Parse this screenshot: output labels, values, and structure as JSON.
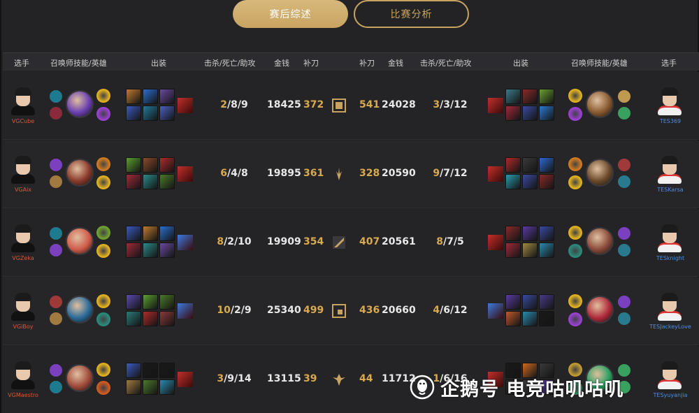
{
  "tabs": [
    {
      "label": "赛后综述",
      "active": true
    },
    {
      "label": "比赛分析",
      "active": false
    }
  ],
  "header": {
    "left": {
      "player": "选手",
      "spells_champ": "召唤师技能/英雄",
      "items": "出装",
      "kda": "击杀/死亡/助攻",
      "gold": "金钱",
      "cs": "补刀"
    },
    "right": {
      "cs": "补刀",
      "gold": "金钱",
      "kda": "击杀/死亡/助攻",
      "items": "出装",
      "spells_champ": "召唤师技能/英雄",
      "player": "选手"
    }
  },
  "rows": [
    {
      "lane": "top-icon",
      "left": {
        "name": "VGCube",
        "kda": "2/8/9",
        "k": "2",
        "rest": "/8/9",
        "gold": "18425",
        "cs": "372",
        "spells": [
          "#1e7a8f",
          "#8a2a3a"
        ],
        "champ": "#6a3fb0",
        "runes": [
          "#e0b020",
          "#9a40d0"
        ],
        "items": [
          "#c07a30",
          "#2a6fd0",
          "#6a4aa0",
          "#3a5ac0",
          "#207a9a",
          "#4a60c0"
        ],
        "trinket": "#c0302a"
      },
      "right": {
        "name": "TES369",
        "kda": "3/3/12",
        "k": "3",
        "rest": "/3/12",
        "gold": "24028",
        "cs": "541",
        "spells": [
          "#e0b020",
          "#9a40d0"
        ],
        "champ": "#8a5a30",
        "runes": [
          "#c09a50",
          "#3aa060"
        ],
        "items": [
          "#3a7a8a",
          "#8a2a2a",
          "#6aa030",
          "#a02a3a",
          "#3a4aa0",
          "#2a7ad0"
        ],
        "trinket": "#c0302a"
      }
    },
    {
      "lane": "jungle-icon",
      "left": {
        "name": "VGAix",
        "kda": "6/4/8",
        "k": "6",
        "rest": "/4/8",
        "gold": "19895",
        "cs": "361",
        "spells": [
          "#7a40c0",
          "#a07a40"
        ],
        "champ": "#8a3a2a",
        "runes": [
          "#d07a20",
          "#e0b020"
        ],
        "items": [
          "#5aa030",
          "#8a4a2a",
          "#b02a2a",
          "#a02a3a",
          "#2a8a8a",
          "#4a7a2a"
        ],
        "trinket": "#c0302a"
      },
      "right": {
        "name": "TESKarsa",
        "kda": "9/7/12",
        "k": "9",
        "rest": "/7/12",
        "gold": "20590",
        "cs": "328",
        "spells": [
          "#d07a20",
          "#e0b020"
        ],
        "champ": "#6a4a2a",
        "runes": [
          "#a03a3a",
          "#2a7a8f"
        ],
        "items": [
          "#b02a2a",
          "#3a3a3a",
          "#2a6ad0",
          "#2a9ab0",
          "#3a4aa0",
          "#8a2a2a"
        ],
        "trinket": "#c0302a"
      }
    },
    {
      "lane": "mid-icon",
      "left": {
        "name": "VGZeka",
        "kda": "8/2/10",
        "k": "8",
        "rest": "/2/10",
        "gold": "19909",
        "cs": "354",
        "spells": [
          "#1e7a8f",
          "#7a40c0"
        ],
        "champ": "#d05a4a",
        "runes": [
          "#70a030",
          "#e0b020"
        ],
        "items": [
          "#3a5ac0",
          "#c07a30",
          "#2a6fd0",
          "#a02a3a",
          "#2a8a8a",
          "#6a4aa0"
        ],
        "trinket": "#3a7ae0"
      },
      "right": {
        "name": "TESknight",
        "kda": "8/7/5",
        "k": "8",
        "rest": "/7/5",
        "gold": "20561",
        "cs": "407",
        "spells": [
          "#e0b020",
          "#2a8a7a"
        ],
        "champ": "#8a4a3a",
        "runes": [
          "#7a40c0",
          "#2a7a8f"
        ],
        "items": [
          "#8a2a2a",
          "#5a3aa0",
          "#3a4aa0",
          "#a02a3a",
          "#a08a40",
          "#2a8ab0"
        ],
        "trinket": "#c0302a"
      }
    },
    {
      "lane": "adc-icon",
      "left": {
        "name": "VGiBoy",
        "kda": "10/2/9",
        "k": "10",
        "rest": "/2/9",
        "gold": "25340",
        "cs": "499",
        "spells": [
          "#a03a3a",
          "#a07a40"
        ],
        "champ": "#2a6a9a",
        "runes": [
          "#e0b020",
          "#2a8a7a"
        ],
        "items": [
          "#5a4ab0",
          "#5aa030",
          "#4a7a2a",
          "#2a7a7a",
          "#b02a2a",
          "#8a3a3a"
        ],
        "trinket": "#3a7ae0"
      },
      "right": {
        "name": "TESJackeyLove",
        "kda": "4/6/12",
        "k": "4",
        "rest": "/6/12",
        "gold": "20660",
        "cs": "436",
        "spells": [
          "#e0b020",
          "#9a40d0"
        ],
        "champ": "#b02a3a",
        "runes": [
          "#7a40c0",
          "#2a7a8f"
        ],
        "items": [
          "#5a3aa0",
          "#3a4aa0",
          "#4a3a8a",
          "#c05a2a",
          "#2a8ab0",
          "#1a1a1a"
        ],
        "trinket": "#3a7ae0"
      }
    },
    {
      "lane": "support-icon",
      "left": {
        "name": "VGMaestro",
        "kda": "3/9/14",
        "k": "3",
        "rest": "/9/14",
        "gold": "13115",
        "cs": "39",
        "spells": [
          "#7a40c0",
          "#1e7a8f"
        ],
        "champ": "#a04a3a",
        "runes": [
          "#e0b020",
          "#d05a20"
        ],
        "items": [
          "#3a5ac0",
          "#1a1a1a",
          "#1a1a1a",
          "#a07a40",
          "#4a7a2a",
          "#2a8ab0"
        ],
        "trinket": "#c0302a"
      },
      "right": {
        "name": "TESyuyanjia",
        "kda": "1/6/16",
        "k": "1",
        "rest": "/6/16",
        "gold": "11712",
        "cs": "44",
        "spells": [
          "#c09a30",
          "#2a8a5a"
        ],
        "champ": "#2aa060",
        "runes": [
          "#3aa060",
          "#3aa060"
        ],
        "items": [
          "#1a1a1a",
          "#d06a20",
          "#3a3a3a",
          "#2a2a2a",
          "#3a3a3a",
          "#5a3aa0"
        ],
        "trinket": "#c0302a"
      }
    }
  ],
  "watermark": {
    "text": "企鹅号 电竞咕叽咕叽"
  }
}
